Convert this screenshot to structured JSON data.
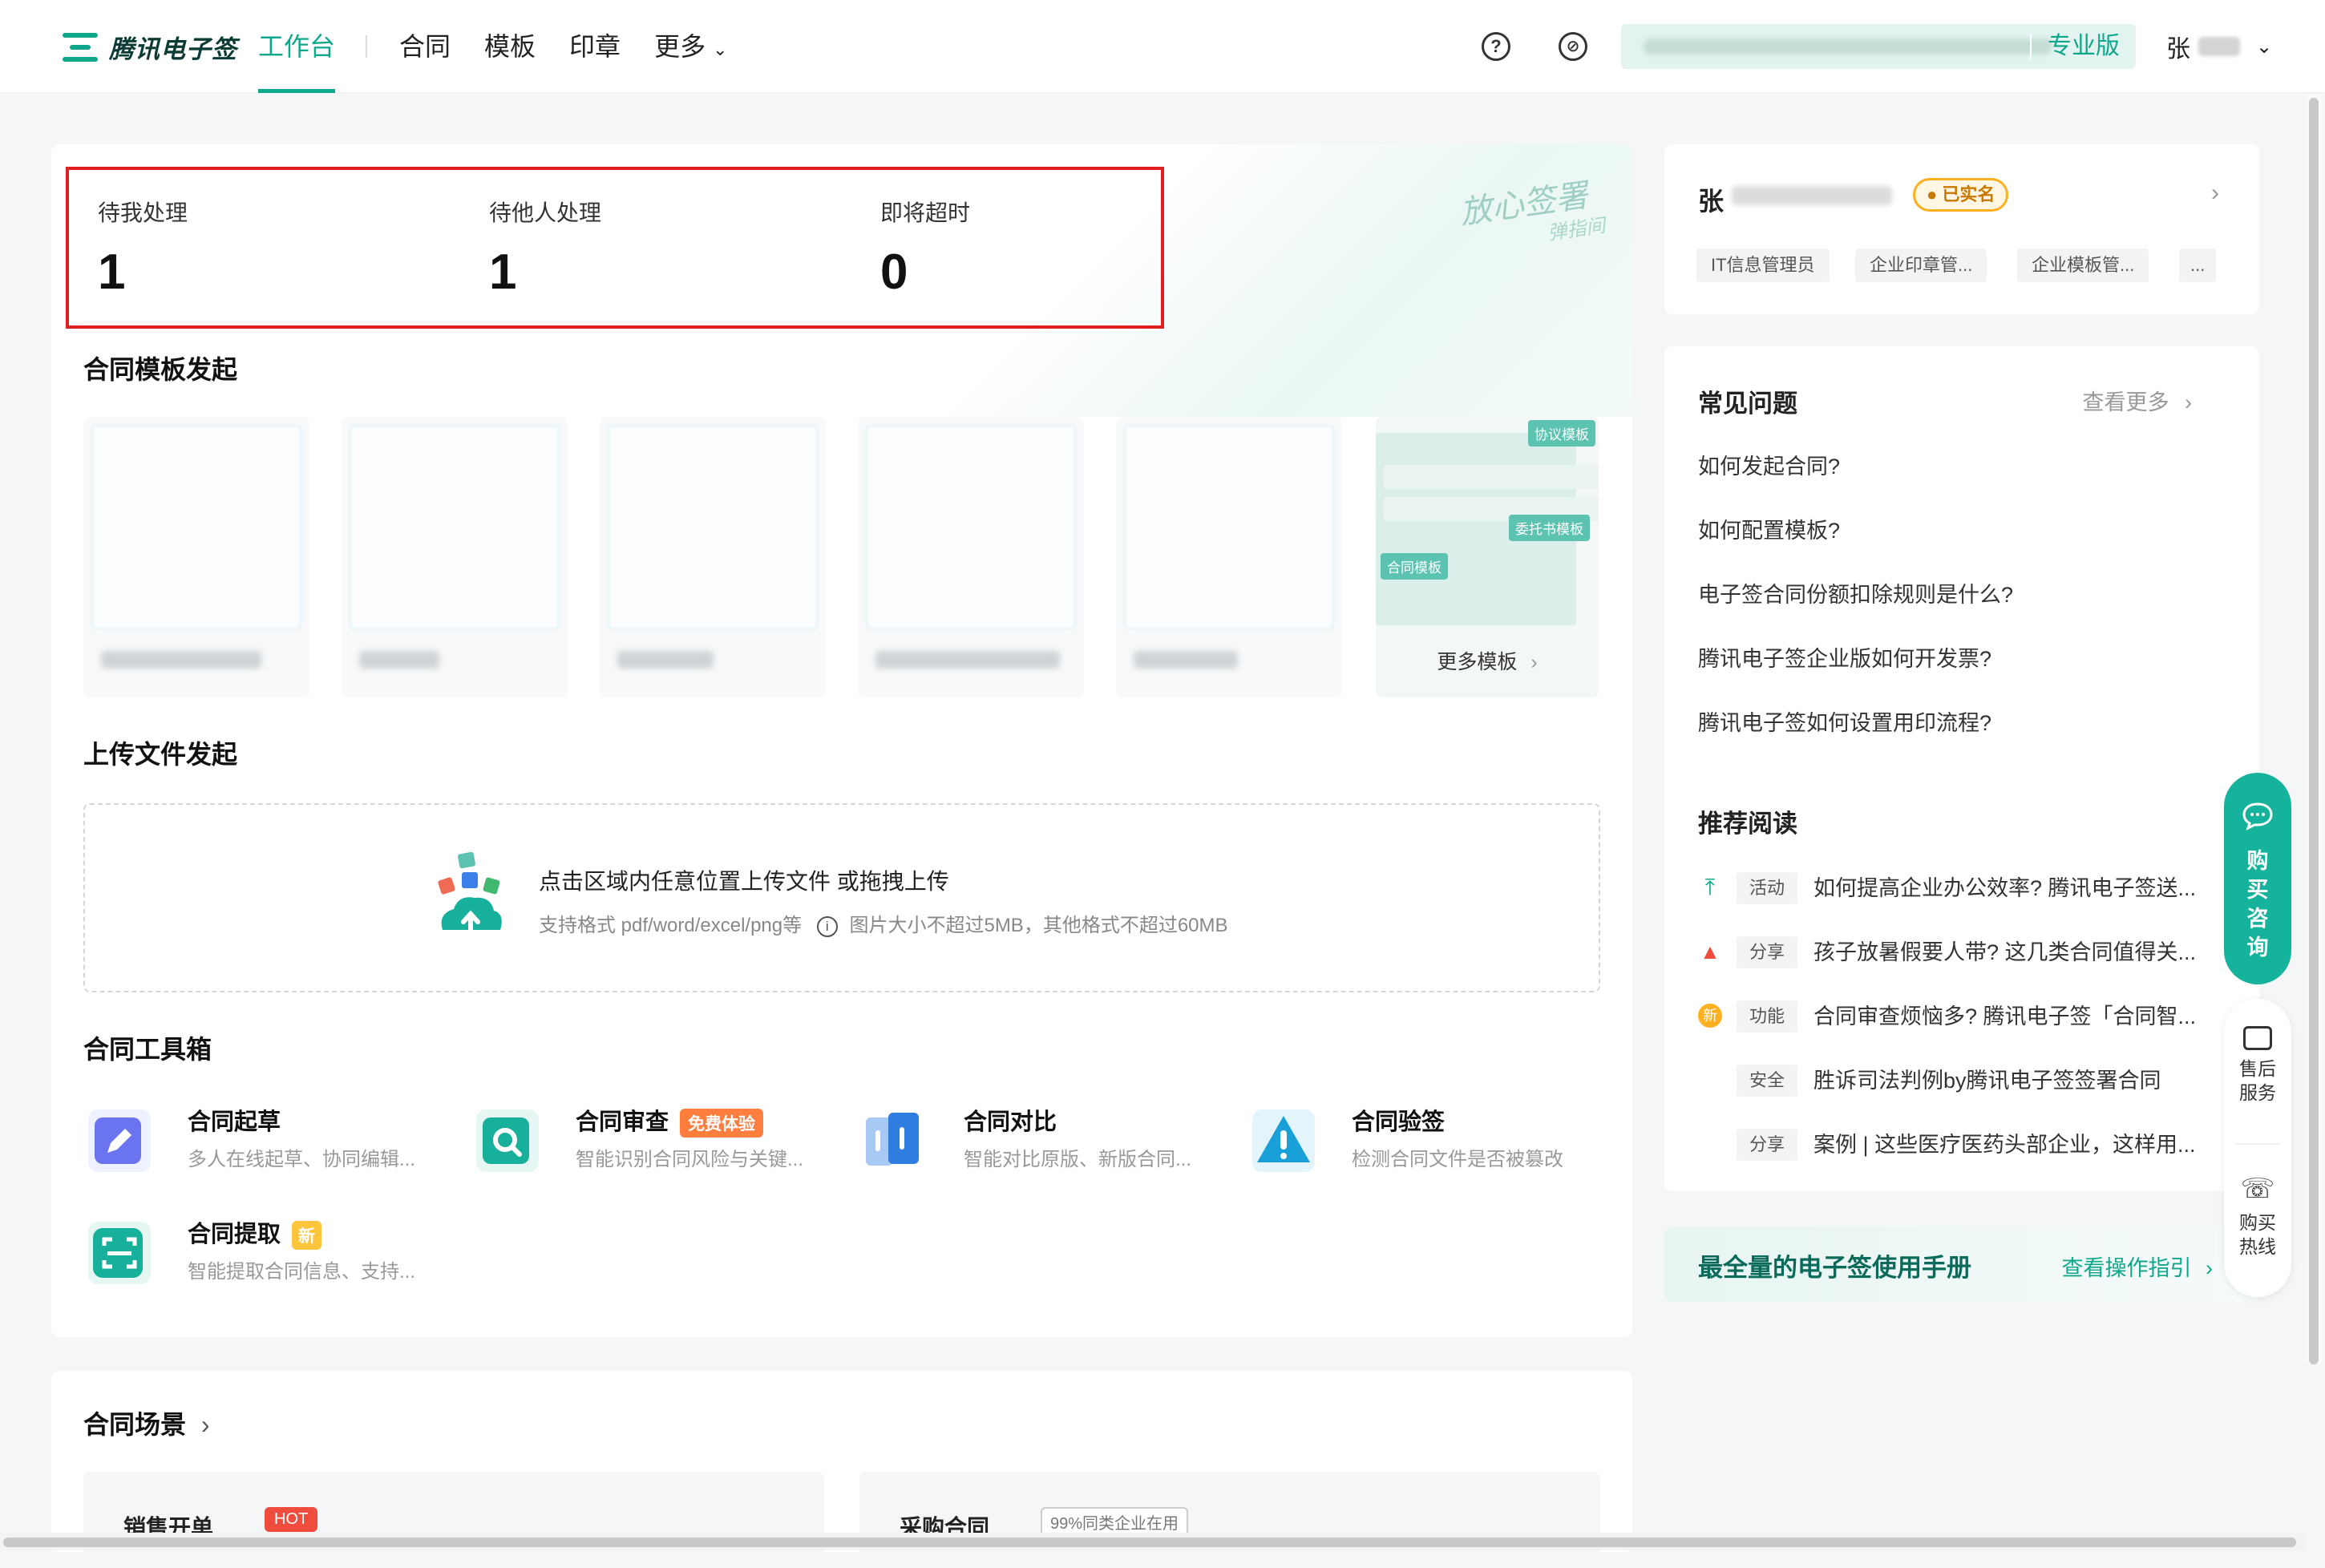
{
  "brand": {
    "name": "腾讯电子签",
    "color": "#0fa78c"
  },
  "nav": {
    "items": [
      "工作台",
      "合同",
      "模板",
      "印章"
    ],
    "more": "更多",
    "active_index": 0
  },
  "header": {
    "help_icon": "?",
    "link_icon": "⊘",
    "edition": "专业版",
    "user_initial": "张"
  },
  "stats": [
    {
      "label": "待我处理",
      "value": "1"
    },
    {
      "label": "待他人处理",
      "value": "1"
    },
    {
      "label": "即将超时",
      "value": "0"
    }
  ],
  "slogan": {
    "line1": "放心签署",
    "line2": "弹指间"
  },
  "templates": {
    "title": "合同模板发起",
    "more_label": "更多模板",
    "more_tags": [
      "协议模板",
      "委托书模板",
      "合同模板"
    ]
  },
  "upload": {
    "title": "上传文件发起",
    "main_text": "点击区域内任意位置上传文件 或拖拽上传",
    "formats": "支持格式 pdf/word/excel/png等",
    "limits": "图片大小不超过5MB，其他格式不超过60MB"
  },
  "toolbox": {
    "title": "合同工具箱",
    "tools": [
      {
        "name": "合同起草",
        "desc": "多人在线起草、协同编辑...",
        "tag": ""
      },
      {
        "name": "合同审查",
        "desc": "智能识别合同风险与关键...",
        "tag": "免费体验"
      },
      {
        "name": "合同对比",
        "desc": "智能对比原版、新版合同...",
        "tag": ""
      },
      {
        "name": "合同验签",
        "desc": "检测合同文件是否被篡改",
        "tag": ""
      },
      {
        "name": "合同提取",
        "desc": "智能提取合同信息、支持...",
        "tag": "新"
      }
    ]
  },
  "scene": {
    "title": "合同场景",
    "cards": [
      "销售开单",
      "采购合同"
    ],
    "hot": "HOT",
    "usage": "99%同类企业在用"
  },
  "profile": {
    "name": "张",
    "verified": "已实名",
    "roles": [
      "IT信息管理员",
      "企业印章管...",
      "企业模板管...",
      "..."
    ]
  },
  "faq": {
    "title": "常见问题",
    "more": "查看更多",
    "items": [
      "如何发起合同?",
      "如何配置模板?",
      "电子签合同份额扣除规则是什么?",
      "腾讯电子签企业版如何开发票?",
      "腾讯电子签如何设置用印流程?"
    ]
  },
  "recommend": {
    "title": "推荐阅读",
    "items": [
      {
        "tag": "活动",
        "text": "如何提高企业办公效率? 腾讯电子签送...",
        "icon": "top-icon",
        "color": "#0fa78c"
      },
      {
        "tag": "分享",
        "text": "孩子放暑假要人带? 这几类合同值得关...",
        "icon": "fire-icon",
        "color": "#f04c3e"
      },
      {
        "tag": "功能",
        "text": "合同审查烦恼多? 腾讯电子签「合同智...",
        "icon": "new-icon",
        "color": "#ffb020"
      },
      {
        "tag": "安全",
        "text": "胜诉司法判例by腾讯电子签签署合同",
        "icon": "",
        "color": ""
      },
      {
        "tag": "分享",
        "text": "案例 | 这些医疗医药头部企业，这样用...",
        "icon": "",
        "color": ""
      }
    ]
  },
  "manual": {
    "title": "最全量的电子签使用手册",
    "link": "查看操作指引"
  },
  "floating": {
    "consult": "购买咨询",
    "after_sales": "售后服务",
    "hotline": "购买热线"
  }
}
